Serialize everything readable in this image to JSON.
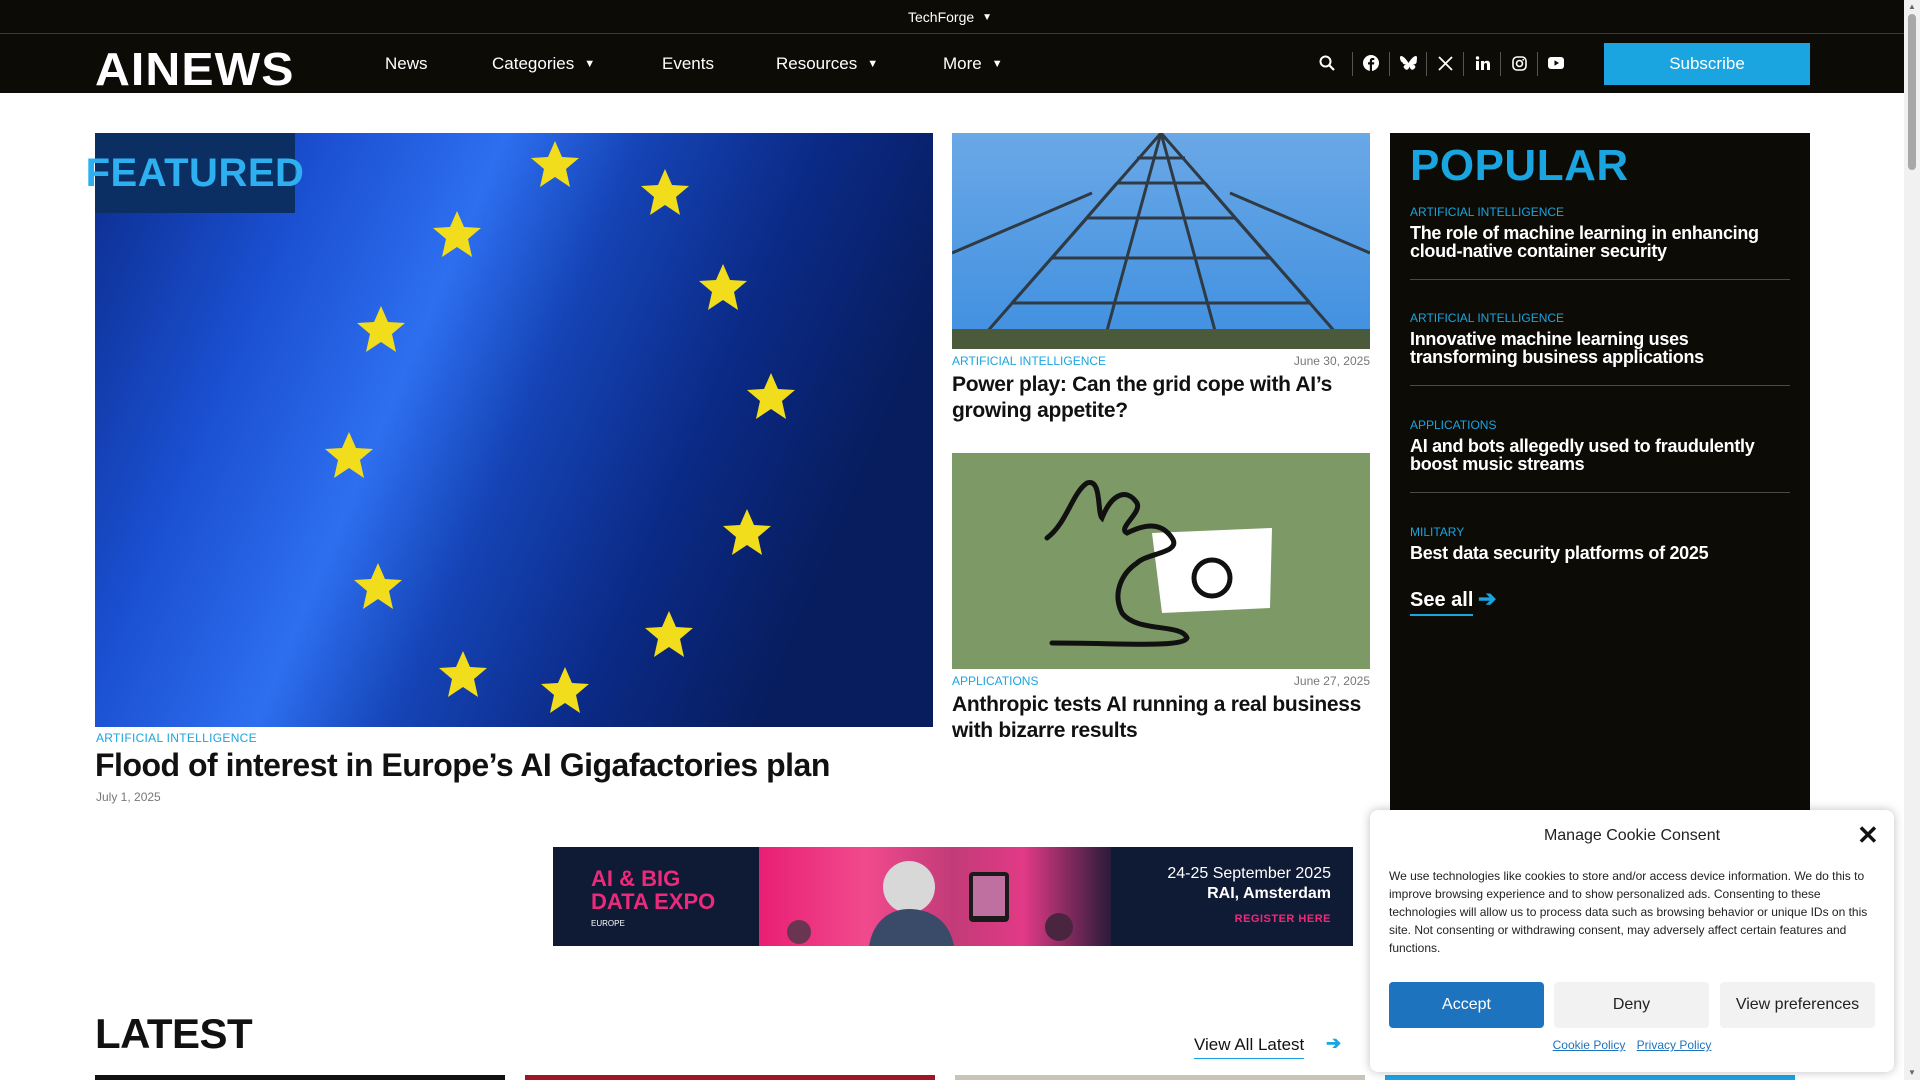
{
  "topbar": {
    "brand": "TechForge"
  },
  "nav": {
    "logo": "AINEWS",
    "items": [
      {
        "label": "News"
      },
      {
        "label": "Categories"
      },
      {
        "label": "Events"
      },
      {
        "label": "Resources"
      },
      {
        "label": "More"
      }
    ],
    "subscribe": "Subscribe"
  },
  "featured": {
    "badge": "FEATURED",
    "category": "ARTIFICIAL INTELLIGENCE",
    "title": "Flood of interest in Europe’s AI Gigafactories plan",
    "date": "July 1, 2025"
  },
  "cards": [
    {
      "category": "ARTIFICIAL INTELLIGENCE",
      "date": "June 30, 2025",
      "title": "Power play: Can the grid cope with AI’s growing appetite?"
    },
    {
      "category": "APPLICATIONS",
      "date": "June 27, 2025",
      "title": "Anthropic tests AI running a real business with bizarre results"
    }
  ],
  "popular": {
    "heading": "POPULAR",
    "items": [
      {
        "category": "ARTIFICIAL INTELLIGENCE",
        "title": "The role of machine learning in enhancing cloud-native container security"
      },
      {
        "category": "ARTIFICIAL INTELLIGENCE",
        "title": "Innovative machine learning uses transforming business applications"
      },
      {
        "category": "APPLICATIONS",
        "title": "AI and bots allegedly used to fraudulently boost music streams"
      },
      {
        "category": "MILITARY",
        "title": "Best data security platforms of 2025"
      }
    ],
    "see_all": "See all"
  },
  "banner": {
    "brand_line1": "AI & BIG",
    "brand_line2": "DATA EXPO",
    "brand_sub": "EUROPE",
    "date": "24-25 September 2025",
    "venue": "RAI, Amsterdam",
    "cta": "REGISTER HERE"
  },
  "latest": {
    "heading": "LATEST",
    "view_all": "View All Latest"
  },
  "cookie": {
    "title": "Manage Cookie Consent",
    "text": "We use technologies like cookies to store and/or access device information. We do this to improve browsing experience and to show personalized ads. Consenting to these technologies will allow us to process data such as browsing behavior or unique IDs on this site. Not consenting or withdrawing consent, may adversely affect certain features and functions.",
    "accept": "Accept",
    "deny": "Deny",
    "preferences": "View preferences",
    "cookie_policy": "Cookie Policy",
    "privacy_policy": "Privacy Policy"
  },
  "colors": {
    "accent": "#1aa4e0",
    "nav_bg": "#0d0b06",
    "accept": "#1e73be"
  },
  "icons": [
    "search-icon",
    "facebook-icon",
    "bluesky-icon",
    "x-icon",
    "linkedin-icon",
    "instagram-icon",
    "youtube-icon",
    "close-icon",
    "arrow-right-icon",
    "caret-down-icon"
  ]
}
